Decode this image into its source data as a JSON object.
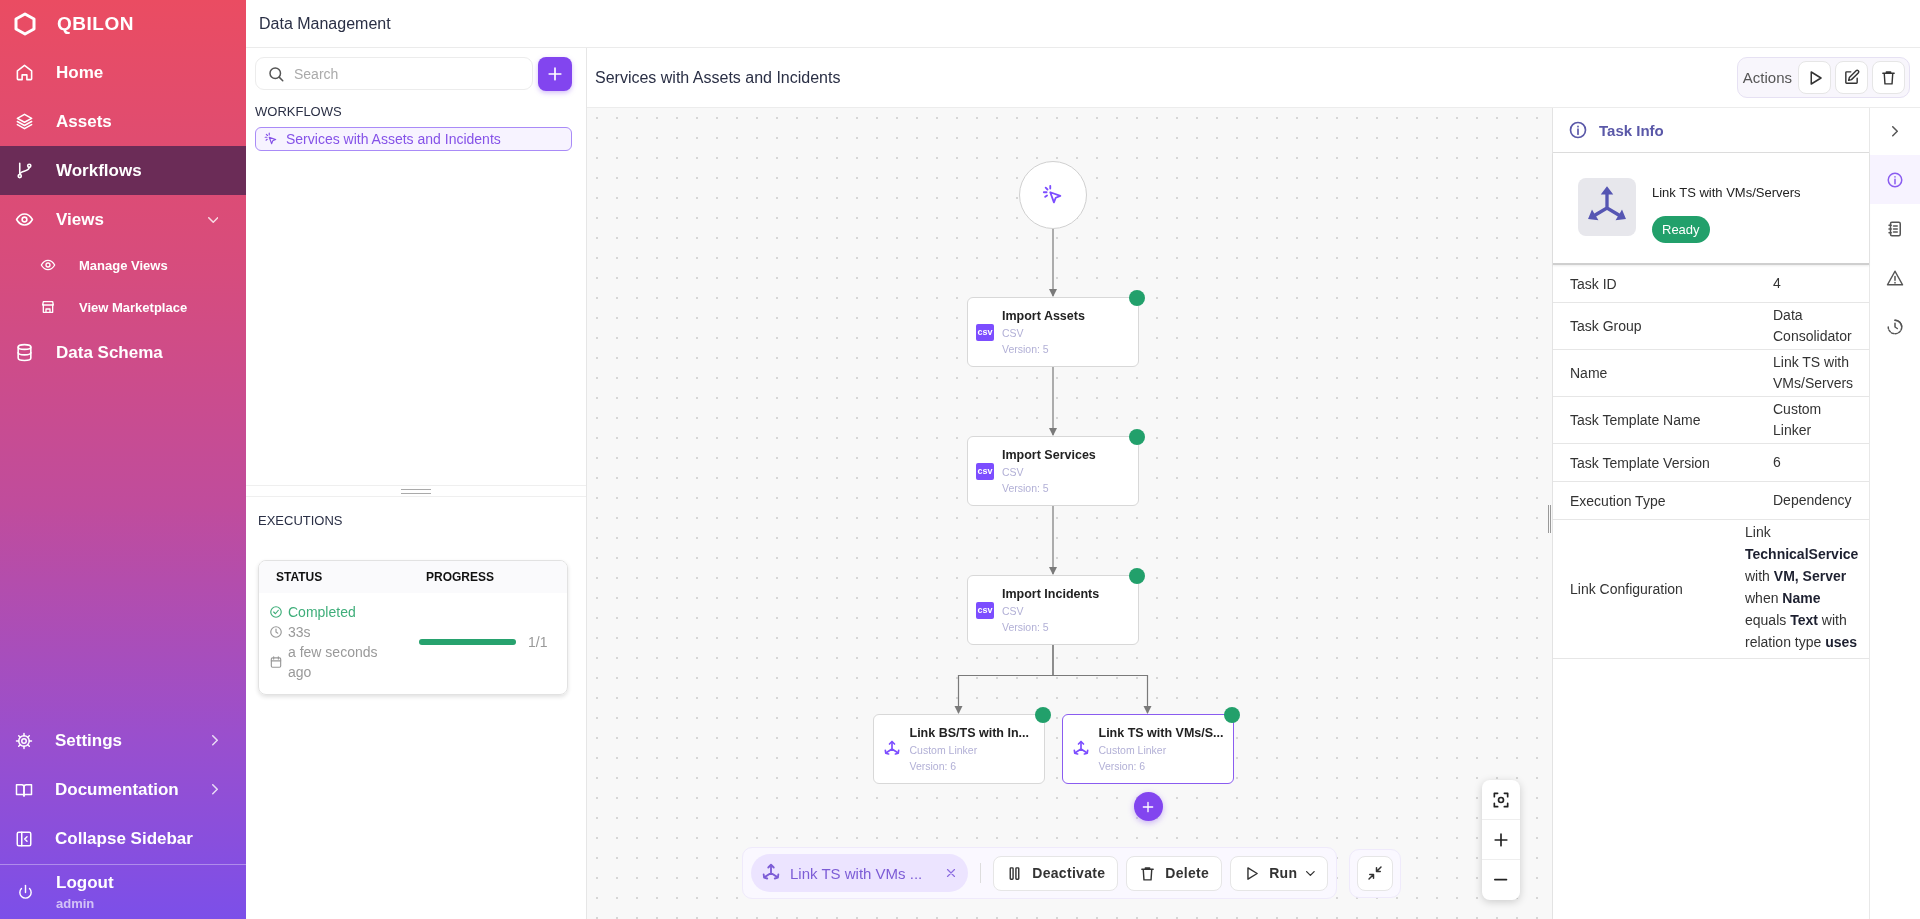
{
  "sidebar": {
    "logo": "QBILON",
    "items": [
      {
        "label": "Home",
        "selected": false
      },
      {
        "label": "Assets",
        "selected": false
      },
      {
        "label": "Workflows",
        "selected": true
      },
      {
        "label": "Views",
        "selected": false,
        "expanded": true,
        "children": [
          {
            "label": "Manage Views",
            "selected": false
          },
          {
            "label": "View Marketplace",
            "selected": false
          }
        ]
      },
      {
        "label": "Data Schema",
        "selected": false
      }
    ],
    "footer_items": [
      {
        "label": "Settings",
        "has_submenu": true
      },
      {
        "label": "Documentation",
        "has_submenu": true
      },
      {
        "label": "Collapse Sidebar",
        "has_submenu": false
      }
    ],
    "user": {
      "action": "Logout",
      "name": "admin"
    }
  },
  "header": {
    "title": "Data Management"
  },
  "workflows_panel": {
    "search": {
      "placeholder": "Search"
    },
    "section_title": "WORKFLOWS",
    "items": [
      {
        "label": "Services with Assets and Incidents",
        "selected": true
      }
    ],
    "executions_title": "EXECUTIONS",
    "executions": {
      "columns": [
        "STATUS",
        "PROGRESS"
      ],
      "rows": [
        {
          "status": "Completed",
          "duration": "33s",
          "started": "a few seconds ago",
          "level": 1,
          "progress": "1/1"
        }
      ]
    }
  },
  "workflow": {
    "title": "Services with Assets and Incidents",
    "actions": {
      "label": "Actions"
    },
    "tree": {
      "kind": "trigger",
      "children": [
        {
          "kind": "csv",
          "title": "Import Assets",
          "badge": "csv",
          "type": "CSV",
          "version": "Version: 5",
          "done": true,
          "selected": false,
          "children": [
            {
              "kind": "csv",
              "title": "Import Services",
              "badge": "csv",
              "type": "CSV",
              "version": "Version: 5",
              "done": true,
              "selected": false,
              "children": [
                {
                  "kind": "csv",
                  "title": "Import Incidents",
                  "badge": "csv",
                  "type": "CSV",
                  "version": "Version: 5",
                  "done": true,
                  "selected": false,
                  "children": [
                    {
                      "kind": "linker",
                      "title": "Link BS/TS with In...",
                      "type": "Custom Linker",
                      "version": "Version: 6",
                      "done": true,
                      "selected": false
                    },
                    {
                      "kind": "linker",
                      "title": "Link TS with VMs/S...",
                      "type": "Custom Linker",
                      "version": "Version: 6",
                      "done": true,
                      "selected": true
                    }
                  ]
                }
              ]
            }
          ]
        }
      ]
    },
    "selection_bar": {
      "chip": "Link TS with VMs ...",
      "buttons": [
        {
          "label": "Deactivate",
          "has_menu": false
        },
        {
          "label": "Delete",
          "has_menu": false
        },
        {
          "label": "Run",
          "has_menu": true
        }
      ]
    }
  },
  "task_info": {
    "title": "Task Info",
    "name": "Link TS with VMs/Servers",
    "status": "Ready",
    "rows": [
      {
        "label": "Task ID",
        "value": "4"
      },
      {
        "label": "Task Group",
        "value": "Data Consolidator"
      },
      {
        "label": "Name",
        "value": "Link TS with VMs/Servers"
      },
      {
        "label": "Task Template Name",
        "value": "Custom Linker"
      },
      {
        "label": "Task Template Version",
        "value": "6"
      },
      {
        "label": "Execution Type",
        "value": "Dependency"
      },
      {
        "label": "Link Configuration",
        "value": "Link **TechnicalService** with **VM, Server** when **Name** equals **Text** with relation type **uses**",
        "kind": "wide"
      }
    ],
    "rail": [
      {
        "selected": true
      },
      {
        "selected": false
      },
      {
        "selected": false
      },
      {
        "selected": false
      }
    ]
  }
}
